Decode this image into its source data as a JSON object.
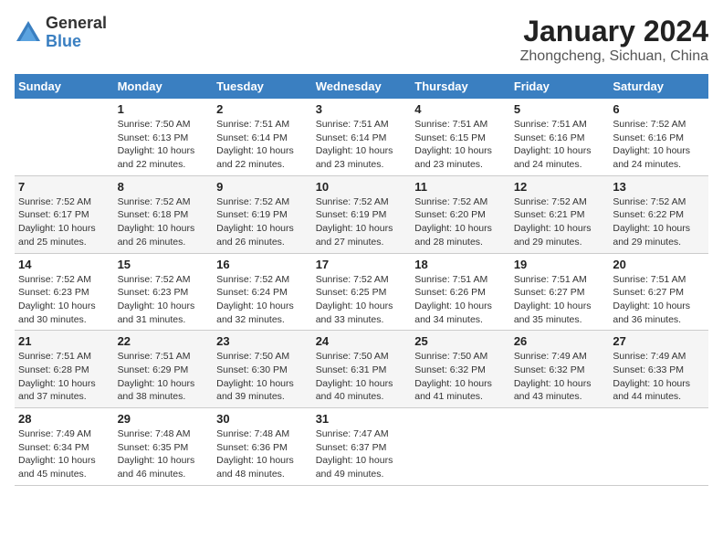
{
  "header": {
    "logo_general": "General",
    "logo_blue": "Blue",
    "month_title": "January 2024",
    "subtitle": "Zhongcheng, Sichuan, China"
  },
  "days_of_week": [
    "Sunday",
    "Monday",
    "Tuesday",
    "Wednesday",
    "Thursday",
    "Friday",
    "Saturday"
  ],
  "weeks": [
    [
      {
        "day": "",
        "info": ""
      },
      {
        "day": "1",
        "info": "Sunrise: 7:50 AM\nSunset: 6:13 PM\nDaylight: 10 hours\nand 22 minutes."
      },
      {
        "day": "2",
        "info": "Sunrise: 7:51 AM\nSunset: 6:14 PM\nDaylight: 10 hours\nand 22 minutes."
      },
      {
        "day": "3",
        "info": "Sunrise: 7:51 AM\nSunset: 6:14 PM\nDaylight: 10 hours\nand 23 minutes."
      },
      {
        "day": "4",
        "info": "Sunrise: 7:51 AM\nSunset: 6:15 PM\nDaylight: 10 hours\nand 23 minutes."
      },
      {
        "day": "5",
        "info": "Sunrise: 7:51 AM\nSunset: 6:16 PM\nDaylight: 10 hours\nand 24 minutes."
      },
      {
        "day": "6",
        "info": "Sunrise: 7:52 AM\nSunset: 6:16 PM\nDaylight: 10 hours\nand 24 minutes."
      }
    ],
    [
      {
        "day": "7",
        "info": "Sunrise: 7:52 AM\nSunset: 6:17 PM\nDaylight: 10 hours\nand 25 minutes."
      },
      {
        "day": "8",
        "info": "Sunrise: 7:52 AM\nSunset: 6:18 PM\nDaylight: 10 hours\nand 26 minutes."
      },
      {
        "day": "9",
        "info": "Sunrise: 7:52 AM\nSunset: 6:19 PM\nDaylight: 10 hours\nand 26 minutes."
      },
      {
        "day": "10",
        "info": "Sunrise: 7:52 AM\nSunset: 6:19 PM\nDaylight: 10 hours\nand 27 minutes."
      },
      {
        "day": "11",
        "info": "Sunrise: 7:52 AM\nSunset: 6:20 PM\nDaylight: 10 hours\nand 28 minutes."
      },
      {
        "day": "12",
        "info": "Sunrise: 7:52 AM\nSunset: 6:21 PM\nDaylight: 10 hours\nand 29 minutes."
      },
      {
        "day": "13",
        "info": "Sunrise: 7:52 AM\nSunset: 6:22 PM\nDaylight: 10 hours\nand 29 minutes."
      }
    ],
    [
      {
        "day": "14",
        "info": "Sunrise: 7:52 AM\nSunset: 6:23 PM\nDaylight: 10 hours\nand 30 minutes."
      },
      {
        "day": "15",
        "info": "Sunrise: 7:52 AM\nSunset: 6:23 PM\nDaylight: 10 hours\nand 31 minutes."
      },
      {
        "day": "16",
        "info": "Sunrise: 7:52 AM\nSunset: 6:24 PM\nDaylight: 10 hours\nand 32 minutes."
      },
      {
        "day": "17",
        "info": "Sunrise: 7:52 AM\nSunset: 6:25 PM\nDaylight: 10 hours\nand 33 minutes."
      },
      {
        "day": "18",
        "info": "Sunrise: 7:51 AM\nSunset: 6:26 PM\nDaylight: 10 hours\nand 34 minutes."
      },
      {
        "day": "19",
        "info": "Sunrise: 7:51 AM\nSunset: 6:27 PM\nDaylight: 10 hours\nand 35 minutes."
      },
      {
        "day": "20",
        "info": "Sunrise: 7:51 AM\nSunset: 6:27 PM\nDaylight: 10 hours\nand 36 minutes."
      }
    ],
    [
      {
        "day": "21",
        "info": "Sunrise: 7:51 AM\nSunset: 6:28 PM\nDaylight: 10 hours\nand 37 minutes."
      },
      {
        "day": "22",
        "info": "Sunrise: 7:51 AM\nSunset: 6:29 PM\nDaylight: 10 hours\nand 38 minutes."
      },
      {
        "day": "23",
        "info": "Sunrise: 7:50 AM\nSunset: 6:30 PM\nDaylight: 10 hours\nand 39 minutes."
      },
      {
        "day": "24",
        "info": "Sunrise: 7:50 AM\nSunset: 6:31 PM\nDaylight: 10 hours\nand 40 minutes."
      },
      {
        "day": "25",
        "info": "Sunrise: 7:50 AM\nSunset: 6:32 PM\nDaylight: 10 hours\nand 41 minutes."
      },
      {
        "day": "26",
        "info": "Sunrise: 7:49 AM\nSunset: 6:32 PM\nDaylight: 10 hours\nand 43 minutes."
      },
      {
        "day": "27",
        "info": "Sunrise: 7:49 AM\nSunset: 6:33 PM\nDaylight: 10 hours\nand 44 minutes."
      }
    ],
    [
      {
        "day": "28",
        "info": "Sunrise: 7:49 AM\nSunset: 6:34 PM\nDaylight: 10 hours\nand 45 minutes."
      },
      {
        "day": "29",
        "info": "Sunrise: 7:48 AM\nSunset: 6:35 PM\nDaylight: 10 hours\nand 46 minutes."
      },
      {
        "day": "30",
        "info": "Sunrise: 7:48 AM\nSunset: 6:36 PM\nDaylight: 10 hours\nand 48 minutes."
      },
      {
        "day": "31",
        "info": "Sunrise: 7:47 AM\nSunset: 6:37 PM\nDaylight: 10 hours\nand 49 minutes."
      },
      {
        "day": "",
        "info": ""
      },
      {
        "day": "",
        "info": ""
      },
      {
        "day": "",
        "info": ""
      }
    ]
  ]
}
